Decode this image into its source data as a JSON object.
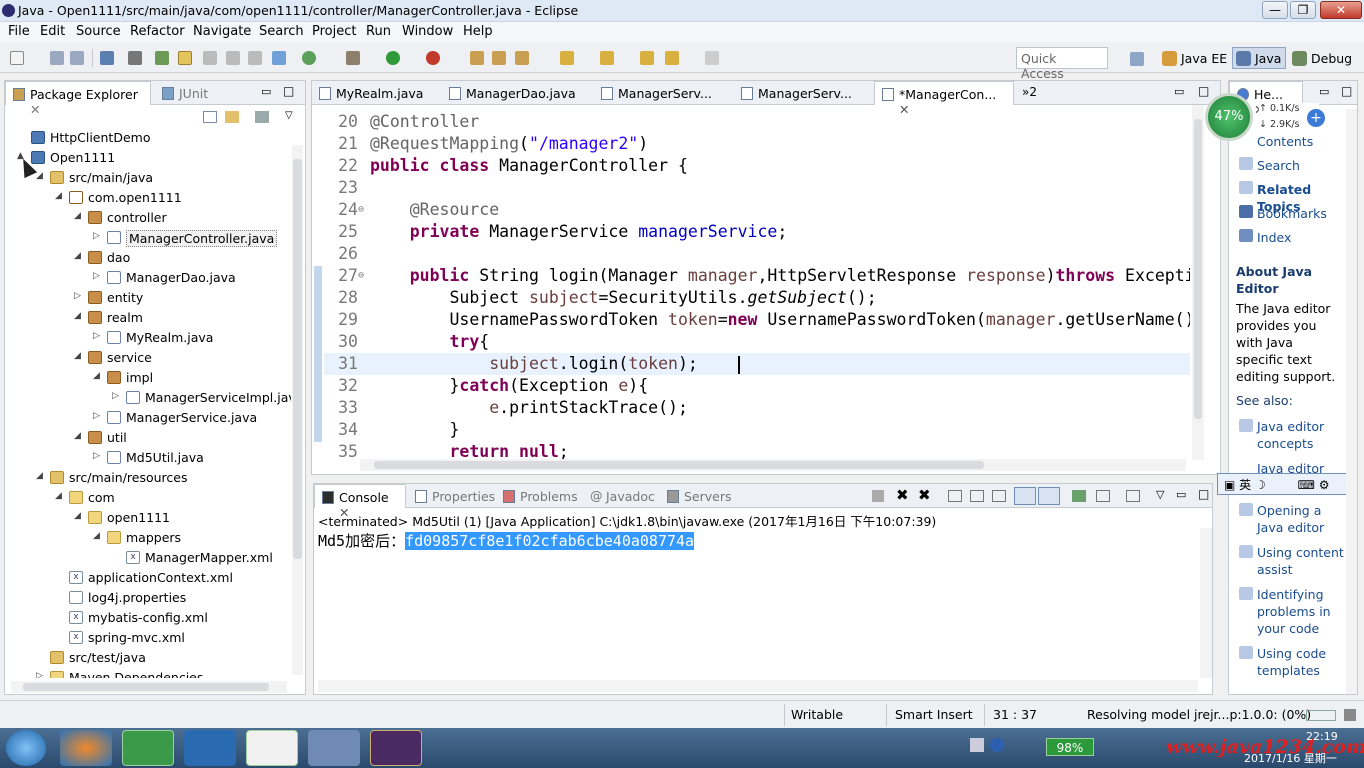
{
  "window": {
    "title": "Java - Open1111/src/main/java/com/open1111/controller/ManagerController.java - Eclipse",
    "controls": [
      "—",
      "❐",
      "✕"
    ]
  },
  "menu": [
    "File",
    "Edit",
    "Source",
    "Refactor",
    "Navigate",
    "Search",
    "Project",
    "Run",
    "Window",
    "Help"
  ],
  "toolbar": {
    "quick_access_placeholder": "Quick Access",
    "perspectives": [
      "Java EE",
      "Java",
      "Debug"
    ]
  },
  "package_explorer": {
    "tabs": [
      "Package Explorer",
      "JUnit"
    ],
    "tree": [
      {
        "label": "HttpClientDemo",
        "depth": 0,
        "icon": "project",
        "twisty": ""
      },
      {
        "label": "Open1111",
        "depth": 0,
        "icon": "project",
        "twisty": "▲"
      },
      {
        "label": "src/main/java",
        "depth": 1,
        "icon": "srcfolder",
        "twisty": "◢"
      },
      {
        "label": "com.open1111",
        "depth": 2,
        "icon": "pkg-empty",
        "twisty": "◢"
      },
      {
        "label": "controller",
        "depth": 3,
        "icon": "pkg",
        "twisty": "◢"
      },
      {
        "label": "ManagerController.java",
        "depth": 4,
        "icon": "java",
        "twisty": "▷",
        "selected": true
      },
      {
        "label": "dao",
        "depth": 3,
        "icon": "pkg",
        "twisty": "◢"
      },
      {
        "label": "ManagerDao.java",
        "depth": 4,
        "icon": "java",
        "twisty": "▷"
      },
      {
        "label": "entity",
        "depth": 3,
        "icon": "pkg",
        "twisty": "▷"
      },
      {
        "label": "realm",
        "depth": 3,
        "icon": "pkg",
        "twisty": "◢"
      },
      {
        "label": "MyRealm.java",
        "depth": 4,
        "icon": "java",
        "twisty": "▷"
      },
      {
        "label": "service",
        "depth": 3,
        "icon": "pkg",
        "twisty": "◢"
      },
      {
        "label": "impl",
        "depth": 4,
        "icon": "pkg",
        "twisty": "◢"
      },
      {
        "label": "ManagerServiceImpl.java",
        "depth": 5,
        "icon": "java",
        "twisty": "▷"
      },
      {
        "label": "ManagerService.java",
        "depth": 4,
        "icon": "java",
        "twisty": "▷"
      },
      {
        "label": "util",
        "depth": 3,
        "icon": "pkg",
        "twisty": "◢"
      },
      {
        "label": "Md5Util.java",
        "depth": 4,
        "icon": "java",
        "twisty": "▷"
      },
      {
        "label": "src/main/resources",
        "depth": 1,
        "icon": "srcfolder",
        "twisty": "◢"
      },
      {
        "label": "com",
        "depth": 2,
        "icon": "folder",
        "twisty": "◢"
      },
      {
        "label": "open1111",
        "depth": 3,
        "icon": "folder",
        "twisty": "◢"
      },
      {
        "label": "mappers",
        "depth": 4,
        "icon": "folder",
        "twisty": "◢"
      },
      {
        "label": "ManagerMapper.xml",
        "depth": 5,
        "icon": "xml",
        "twisty": ""
      },
      {
        "label": "applicationContext.xml",
        "depth": 2,
        "icon": "xml",
        "twisty": ""
      },
      {
        "label": "log4j.properties",
        "depth": 2,
        "icon": "props",
        "twisty": ""
      },
      {
        "label": "mybatis-config.xml",
        "depth": 2,
        "icon": "xml",
        "twisty": ""
      },
      {
        "label": "spring-mvc.xml",
        "depth": 2,
        "icon": "xml",
        "twisty": ""
      },
      {
        "label": "src/test/java",
        "depth": 1,
        "icon": "srcfolder",
        "twisty": ""
      },
      {
        "label": "Maven Dependencies",
        "depth": 1,
        "icon": "folder",
        "twisty": "▷"
      }
    ]
  },
  "editor": {
    "tabs": [
      "MyRealm.java",
      "ManagerDao.java",
      "ManagerServ...",
      "ManagerServ...",
      "*ManagerCon..."
    ],
    "overflow_count": "»2",
    "lines": [
      {
        "n": "20",
        "tokens": [
          [
            "an",
            "@Controller"
          ]
        ]
      },
      {
        "n": "21",
        "tokens": [
          [
            "an",
            "@RequestMapping"
          ],
          [
            "",
            "("
          ],
          [
            "st",
            "\"/manager2\""
          ],
          [
            "",
            ")"
          ]
        ]
      },
      {
        "n": "22",
        "tokens": [
          [
            "kw",
            "public"
          ],
          [
            "",
            " "
          ],
          [
            "kw",
            "class"
          ],
          [
            "",
            " ManagerController {"
          ]
        ]
      },
      {
        "n": "23",
        "tokens": []
      },
      {
        "n": "24",
        "fold": "⊖",
        "tokens": [
          [
            "",
            "    "
          ],
          [
            "an",
            "@Resource"
          ]
        ]
      },
      {
        "n": "25",
        "tokens": [
          [
            "",
            "    "
          ],
          [
            "kw",
            "private"
          ],
          [
            "",
            " ManagerService "
          ],
          [
            "fd",
            "managerService"
          ],
          [
            "",
            ";"
          ]
        ]
      },
      {
        "n": "26",
        "tokens": []
      },
      {
        "n": "27",
        "fold": "⊖",
        "tokens": [
          [
            "",
            "    "
          ],
          [
            "kw",
            "public"
          ],
          [
            "",
            " String login(Manager "
          ],
          [
            "pm",
            "manager"
          ],
          [
            "",
            ",HttpServletResponse "
          ],
          [
            "pm",
            "response"
          ],
          [
            "",
            ")"
          ],
          [
            "kw",
            "throws"
          ],
          [
            "",
            " Excepti"
          ]
        ]
      },
      {
        "n": "28",
        "tokens": [
          [
            "",
            "        Subject "
          ],
          [
            "pm",
            "subject"
          ],
          [
            "",
            "=SecurityUtils."
          ],
          [
            "it",
            "getSubject"
          ],
          [
            "",
            "();"
          ]
        ]
      },
      {
        "n": "29",
        "tokens": [
          [
            "",
            "        UsernamePasswordToken "
          ],
          [
            "pm",
            "token"
          ],
          [
            "",
            "="
          ],
          [
            "kw",
            "new"
          ],
          [
            "",
            " UsernamePasswordToken("
          ],
          [
            "pm",
            "manager"
          ],
          [
            "",
            ".getUserName()"
          ]
        ]
      },
      {
        "n": "30",
        "tokens": [
          [
            "",
            "        "
          ],
          [
            "kw",
            "try"
          ],
          [
            "",
            "{"
          ]
        ]
      },
      {
        "n": "31",
        "current": true,
        "tokens": [
          [
            "",
            "            "
          ],
          [
            "pm",
            "subject"
          ],
          [
            "",
            ".login("
          ],
          [
            "pm",
            "token"
          ],
          [
            "",
            ");    "
          ]
        ]
      },
      {
        "n": "32",
        "tokens": [
          [
            "",
            "        }"
          ],
          [
            "kw",
            "catch"
          ],
          [
            "",
            "(Exception "
          ],
          [
            "pm",
            "e"
          ],
          [
            "",
            "){"
          ]
        ]
      },
      {
        "n": "33",
        "tokens": [
          [
            "",
            "            "
          ],
          [
            "pm",
            "e"
          ],
          [
            "",
            ".printStackTrace();"
          ]
        ]
      },
      {
        "n": "34",
        "tokens": [
          [
            "",
            "        }"
          ]
        ]
      },
      {
        "n": "35",
        "tokens": [
          [
            "",
            "        "
          ],
          [
            "kw",
            "return"
          ],
          [
            "",
            " "
          ],
          [
            "kw",
            "null"
          ],
          [
            "",
            ";"
          ]
        ]
      }
    ]
  },
  "console": {
    "tabs": [
      "Console",
      "Properties",
      "Problems",
      "Javadoc",
      "Servers"
    ],
    "header": "<terminated> Md5Util (1) [Java Application] C:\\jdk1.8\\bin\\javaw.exe (2017年1月16日 下午10:07:39)",
    "output_prefix": "Md5加密后：",
    "output_selected": "fd09857cf8e1f02cfab6cbe40a08774a"
  },
  "help": {
    "tab": "He...",
    "net_widget": {
      "percent": "47%",
      "up": "0.1K/s",
      "down": "2.9K/s"
    },
    "links": [
      "Contents",
      "Search",
      "Related Topics",
      "Bookmarks",
      "Index"
    ],
    "about_title": "About Java Editor",
    "about_text": "The Java editor provides you with Java specific text editing support.",
    "see_also": "See also:",
    "see_links": [
      "Java editor concepts",
      "Java editor",
      "Opening a Java editor",
      "Using content assist",
      "Identifying problems in your code",
      "Using code templates"
    ],
    "ime_bar": [
      "英",
      "☽"
    ]
  },
  "status": {
    "writable": "Writable",
    "insert_mode": "Smart Insert",
    "position": "31 : 37",
    "task": "Resolving model jrejr...p:1.0.0: (0%)"
  },
  "taskbar": {
    "battery": "98%",
    "time": "22:19",
    "date": "2017/1/16 星期一",
    "watermark": "www.java1234.com"
  },
  "colors": {
    "selection": "#3399ff",
    "current_line": "#e8f2fe",
    "keyword": "#7f0055",
    "string": "#2a00ff",
    "annotation": "#646464",
    "field": "#0000c0"
  }
}
